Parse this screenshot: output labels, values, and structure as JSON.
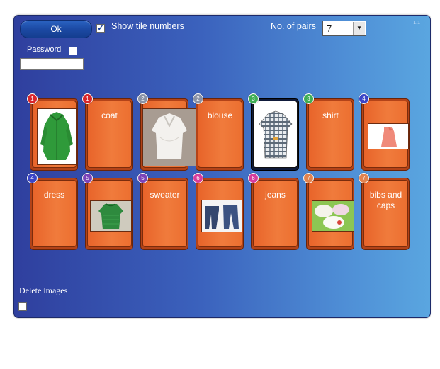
{
  "toolbar": {
    "ok_label": "Ok",
    "show_tile_numbers_label": "Show tile numbers",
    "show_tile_numbers_checked": "✓",
    "pairs_label": "No. of pairs",
    "pairs_value": "7",
    "version": "1.1"
  },
  "password": {
    "label": "Password",
    "value": ""
  },
  "footer": {
    "delete_images_label": "Delete images"
  },
  "colors": {
    "badge_1": "#d9262b",
    "badge_2": "#8a92a6",
    "badge_3": "#3fae55",
    "badge_4": "#3b45c7",
    "badge_5": "#7b44b8",
    "badge_6": "#d73d9c",
    "badge_7": "#e2834f"
  },
  "cards": [
    {
      "num": "1",
      "kind": "image",
      "icon": "green-coat-photo-icon"
    },
    {
      "num": "1",
      "kind": "text",
      "text": "coat"
    },
    {
      "num": "2",
      "kind": "image",
      "icon": "white-blouse-photo-icon"
    },
    {
      "num": "2",
      "kind": "text",
      "text": "blouse"
    },
    {
      "num": "3",
      "kind": "image",
      "icon": "plaid-shirt-photo-icon"
    },
    {
      "num": "3",
      "kind": "text",
      "text": "shirt"
    },
    {
      "num": "4",
      "kind": "image",
      "icon": "pink-dress-photo-icon"
    },
    {
      "num": "4",
      "kind": "text",
      "text": "dress"
    },
    {
      "num": "5",
      "kind": "image",
      "icon": "green-sweater-photo-icon"
    },
    {
      "num": "5",
      "kind": "text",
      "text": "sweater"
    },
    {
      "num": "6",
      "kind": "image",
      "icon": "jeans-photo-icon"
    },
    {
      "num": "6",
      "kind": "text",
      "text": "jeans"
    },
    {
      "num": "7",
      "kind": "image",
      "icon": "bibs-and-caps-photo-icon"
    },
    {
      "num": "7",
      "kind": "text",
      "text": "bibs and caps"
    }
  ]
}
